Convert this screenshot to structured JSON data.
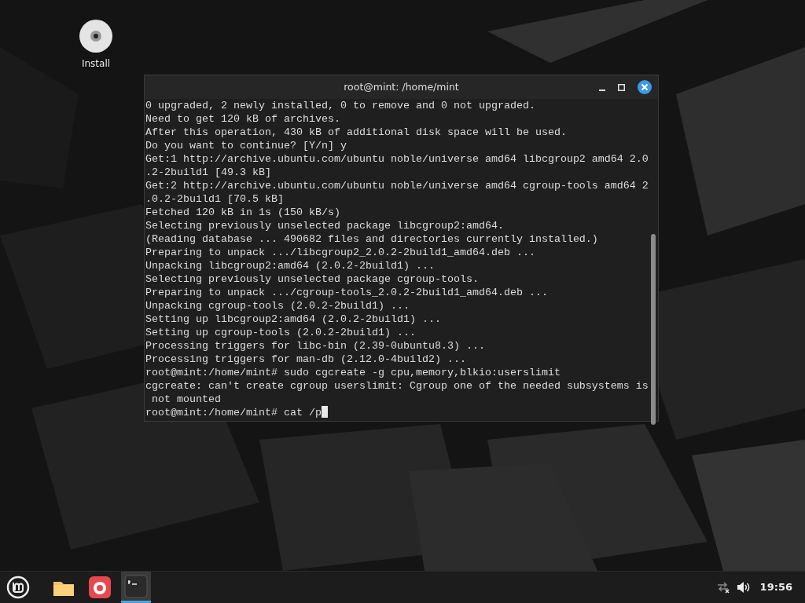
{
  "desktop_icons": [
    {
      "label": "Install"
    }
  ],
  "terminal": {
    "title": "root@mint: /home/mint",
    "cursor_visible": true,
    "lines": [
      "0 upgraded, 2 newly installed, 0 to remove and 0 not upgraded.",
      "Need to get 120 kB of archives.",
      "After this operation, 430 kB of additional disk space will be used.",
      "Do you want to continue? [Y/n] y",
      "Get:1 http://archive.ubuntu.com/ubuntu noble/universe amd64 libcgroup2 amd64 2.0",
      ".2-2build1 [49.3 kB]",
      "Get:2 http://archive.ubuntu.com/ubuntu noble/universe amd64 cgroup-tools amd64 2",
      ".0.2-2build1 [70.5 kB]",
      "Fetched 120 kB in 1s (150 kB/s)",
      "Selecting previously unselected package libcgroup2:amd64.",
      "(Reading database ... 490682 files and directories currently installed.)",
      "Preparing to unpack .../libcgroup2_2.0.2-2build1_amd64.deb ...",
      "Unpacking libcgroup2:amd64 (2.0.2-2build1) ...",
      "Selecting previously unselected package cgroup-tools.",
      "Preparing to unpack .../cgroup-tools_2.0.2-2build1_amd64.deb ...",
      "Unpacking cgroup-tools (2.0.2-2build1) ...",
      "Setting up libcgroup2:amd64 (2.0.2-2build1) ...",
      "Setting up cgroup-tools (2.0.2-2build1) ...",
      "Processing triggers for libc-bin (2.39-0ubuntu8.3) ...",
      "Processing triggers for man-db (2.12.0-4build2) ...",
      "root@mint:/home/mint# sudo cgcreate -g cpu,memory,blkio:userslimit",
      "cgcreate: can't create cgroup userslimit: Cgroup one of the needed subsystems is",
      " not mounted",
      "root@mint:/home/mint# cat /p"
    ]
  },
  "taskbar": {
    "apps": [
      {
        "kind": "files",
        "active": false
      },
      {
        "kind": "browser",
        "active": false
      },
      {
        "kind": "terminal",
        "active": true
      }
    ],
    "clock": "19:56"
  }
}
